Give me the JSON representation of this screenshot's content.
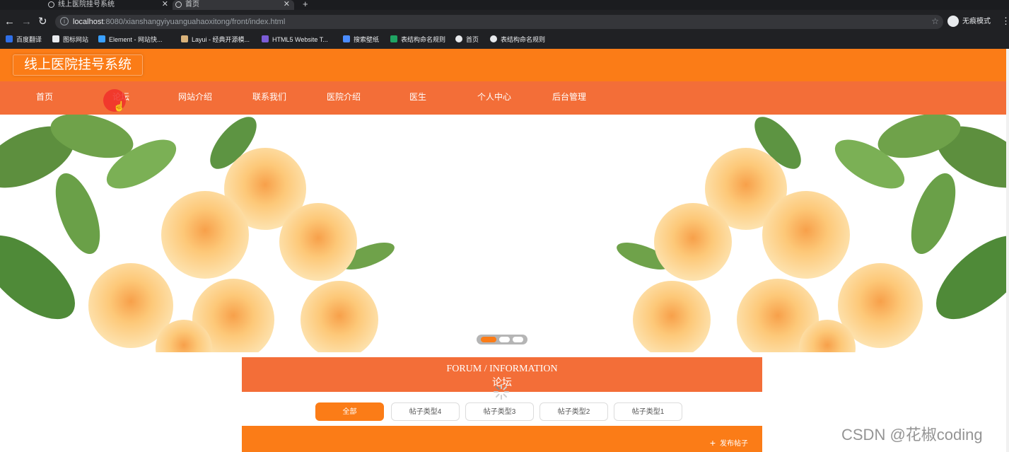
{
  "browser": {
    "tabs": [
      {
        "title": "线上医院挂号系统",
        "active": false
      },
      {
        "title": "首页",
        "active": true
      }
    ],
    "new_tab": "+",
    "url_host": "localhost",
    "url_rest": ":8080/xianshangyiyuanguahaoxitong/front/index.html",
    "profile_label": "无痕模式",
    "bookmarks": [
      {
        "label": "百度翻译",
        "color": "#2f6fe8"
      },
      {
        "label": "图标网站",
        "color": "#e8eaed"
      },
      {
        "label": "Element - 网站快...",
        "color": "#3aa0ff"
      },
      {
        "label": "Layui - 经典开源模...",
        "color": "#d9b27a"
      },
      {
        "label": "HTML5 Website T...",
        "color": "#7b5cd6"
      },
      {
        "label": "搜索壁纸",
        "color": "#4a8cff"
      },
      {
        "label": "表结构命名规则",
        "color": "#1fa463"
      },
      {
        "label": "首页",
        "color": "#e8eaed"
      },
      {
        "label": "表结构命名规则",
        "color": "#e8eaed"
      }
    ]
  },
  "site": {
    "title": "线上医院挂号系统",
    "nav": [
      "首页",
      "论坛",
      "网站介绍",
      "联系我们",
      "医院介绍",
      "医生",
      "个人中心",
      "后台管理"
    ],
    "hovered_nav": "论坛"
  },
  "section": {
    "title_en": "FORUM / INFORMATION",
    "title_cn": "论坛"
  },
  "filters": [
    "全部",
    "帖子类型4",
    "帖子类型3",
    "帖子类型2",
    "帖子类型1"
  ],
  "active_filter": "全部",
  "post_button": "发布帖子",
  "watermark": "CSDN @花椒coding",
  "colors": {
    "header": "#fb7c17",
    "nav": "#f36e38",
    "accent": "#fb7c17"
  }
}
